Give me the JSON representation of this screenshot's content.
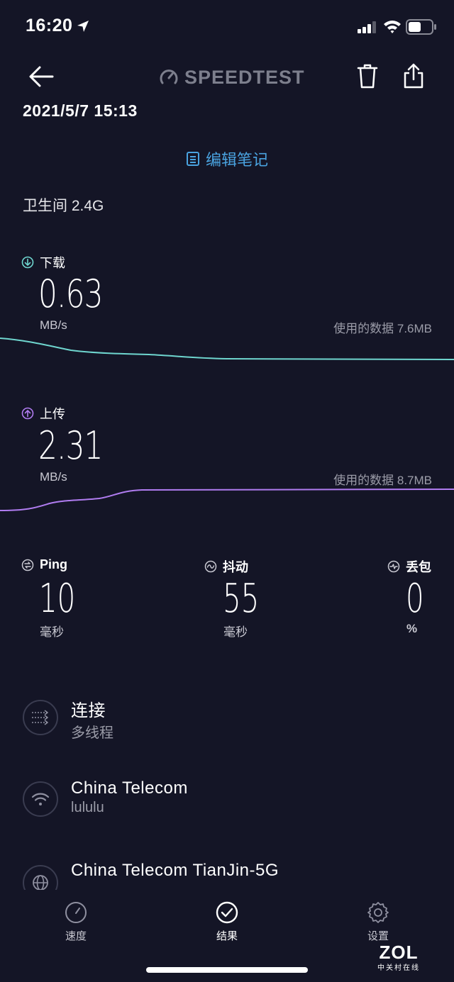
{
  "status_bar": {
    "time": "16:20"
  },
  "header": {
    "brand": "SPEEDTEST"
  },
  "result": {
    "datetime": "2021/5/7 15:13",
    "edit_note": "编辑笔记",
    "network_label": "卫生间 2.4G"
  },
  "download": {
    "label": "下载",
    "value": "0.63",
    "unit": "MB/s",
    "data_used": "使用的数据 7.6MB"
  },
  "upload": {
    "label": "上传",
    "value": "2.31",
    "unit": "MB/s",
    "data_used": "使用的数据 8.7MB"
  },
  "stats": {
    "ping": {
      "label": "Ping",
      "value": "10",
      "unit": "毫秒"
    },
    "jitter": {
      "label": "抖动",
      "value": "55",
      "unit": "毫秒"
    },
    "loss": {
      "label": "丢包",
      "value": "0",
      "unit": "%"
    }
  },
  "info": {
    "connection": {
      "title": "连接",
      "subtitle": "多线程"
    },
    "isp": {
      "title": "China Telecom",
      "subtitle": "lululu"
    },
    "server": {
      "title": "China Telecom TianJin-5G"
    }
  },
  "tabs": [
    {
      "label": "速度",
      "icon": "speedometer-icon"
    },
    {
      "label": "结果",
      "icon": "check-circle-icon"
    },
    {
      "label": "设置",
      "icon": "gear-icon"
    }
  ],
  "watermark": {
    "brand": "ZOL",
    "tagline": "中关村在线"
  },
  "colors": {
    "background": "#141526",
    "download_accent": "#6fd6cf",
    "upload_accent": "#b07cf0",
    "link": "#4aa3e0"
  }
}
